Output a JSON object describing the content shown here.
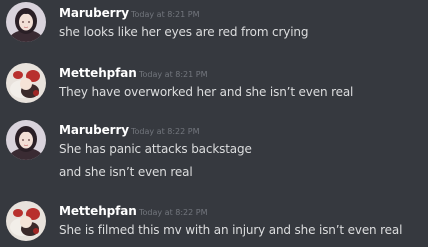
{
  "messages": [
    {
      "author": "Maruberry",
      "timestamp": "Today at 8:21 PM",
      "lines": [
        "she looks like her eyes are red from crying"
      ]
    },
    {
      "author": "Mettehpfan",
      "timestamp": "Today at 8:21 PM",
      "lines": [
        "They have overworked her and she isn’t even real"
      ]
    },
    {
      "author": "Maruberry",
      "timestamp": "Today at 8:22 PM",
      "lines": [
        "She has panic attacks backstage",
        "and she isn’t even real"
      ]
    },
    {
      "author": "Mettehpfan",
      "timestamp": "Today at 8:22 PM",
      "lines": [
        "She is filmed this mv with an injury and she isn’t even real"
      ]
    }
  ],
  "colors": {
    "background": "#36393f",
    "author": "#ffffff",
    "timestamp": "#72767d",
    "message_text": "#dcddde"
  }
}
